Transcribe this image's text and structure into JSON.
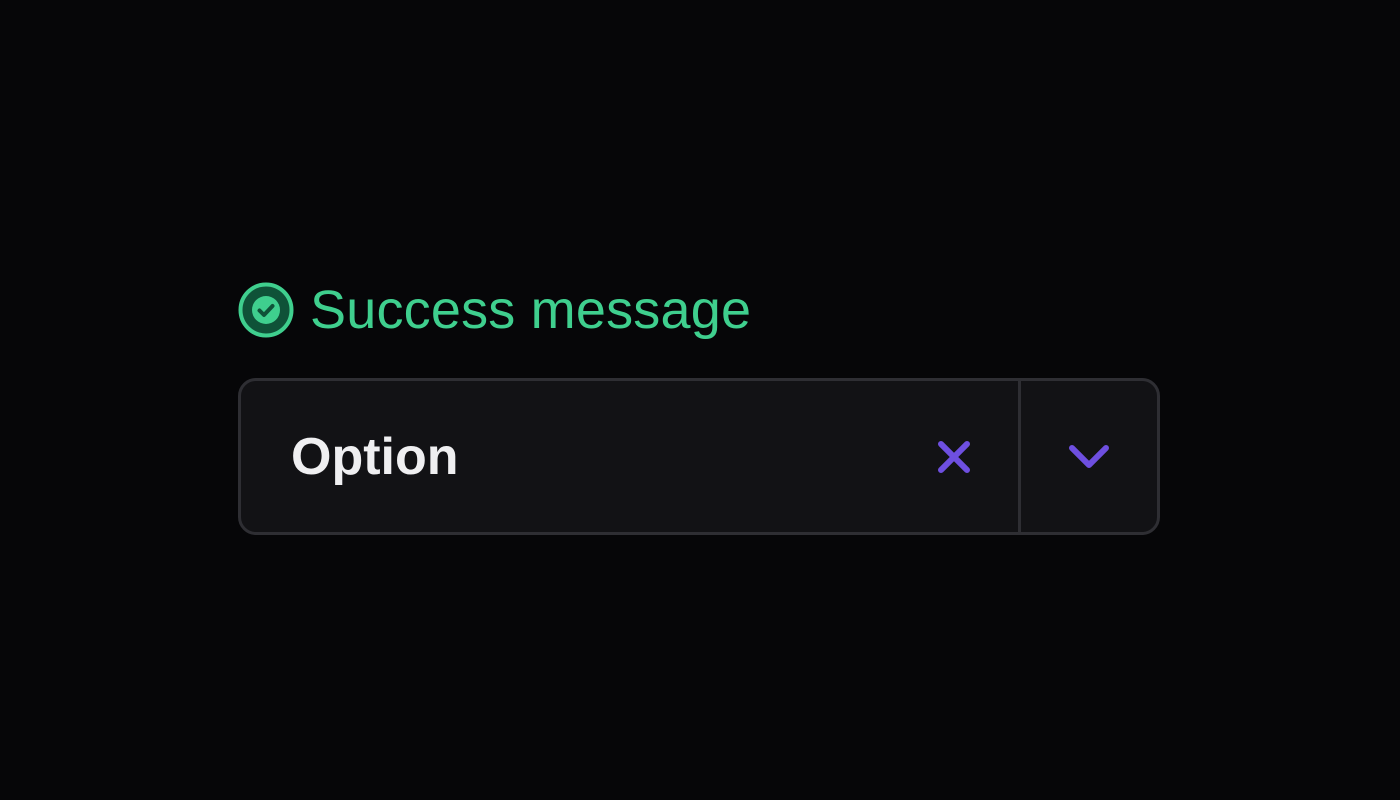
{
  "message": {
    "text": "Success message",
    "status": "success",
    "icon": "check-circle-icon",
    "color": "#3fcf8e"
  },
  "select": {
    "value": "Option",
    "clear_icon": "close-icon",
    "toggle_icon": "chevron-down-icon",
    "accent_color": "#6e4fe0"
  }
}
